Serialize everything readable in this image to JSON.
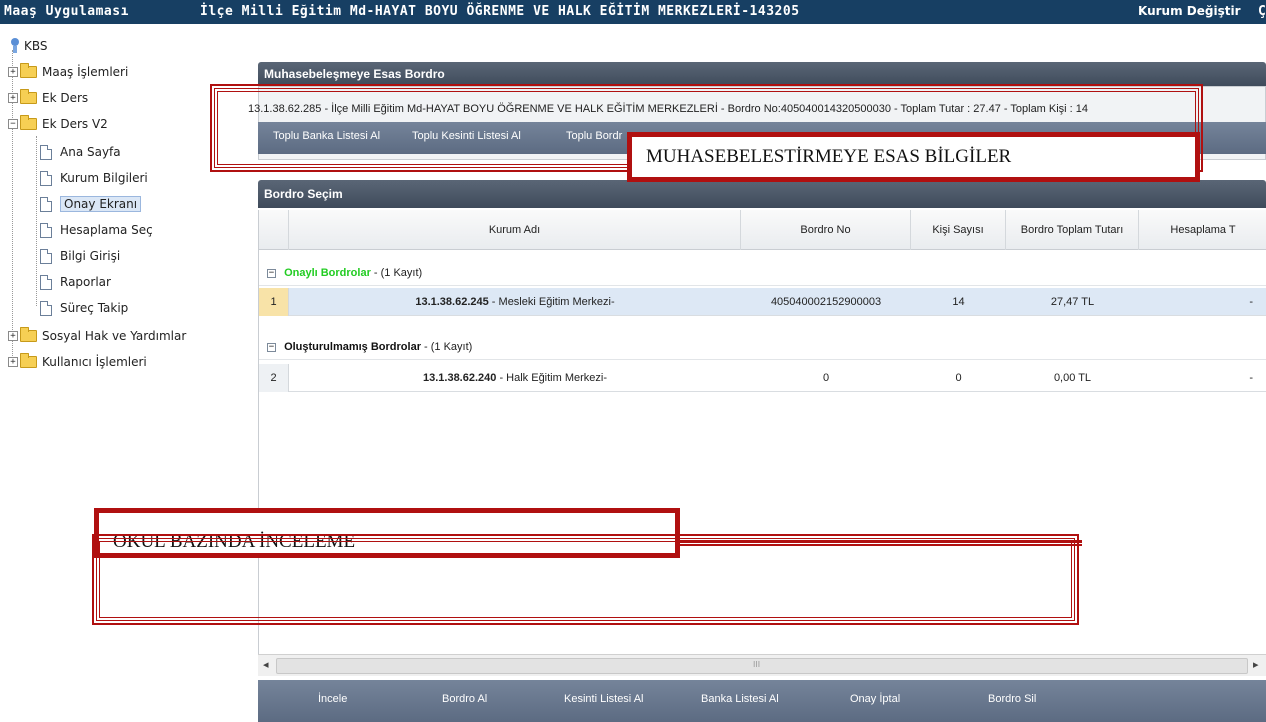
{
  "topbar": {
    "app_title": "Maaş Uygulaması",
    "institution": "İlçe Milli Eğitim Md-HAYAT BOYU ÖĞRENME VE HALK EĞİTİM MERKEZLERİ-143205",
    "change_institution": "Kurum Değiştir",
    "extra": "Ç"
  },
  "sidebar": {
    "root": "KBS",
    "items": [
      {
        "label": "Maaş İşlemleri",
        "type": "folder",
        "expander": "+"
      },
      {
        "label": "Ek Ders",
        "type": "folder",
        "expander": "+"
      },
      {
        "label": "Ek Ders V2",
        "type": "folder",
        "expander": "−"
      },
      {
        "label": "Ana Sayfa",
        "type": "page"
      },
      {
        "label": "Kurum Bilgileri",
        "type": "page"
      },
      {
        "label": "Onay Ekranı",
        "type": "page",
        "selected": true
      },
      {
        "label": "Hesaplama Seç",
        "type": "page"
      },
      {
        "label": "Bilgi Girişi",
        "type": "page"
      },
      {
        "label": "Raporlar",
        "type": "page"
      },
      {
        "label": "Süreç Takip",
        "type": "page"
      },
      {
        "label": "Sosyal Hak ve Yardımlar",
        "type": "folder",
        "expander": "+"
      },
      {
        "label": "Kullanıcı İşlemleri",
        "type": "folder",
        "expander": "+"
      }
    ]
  },
  "summary_panel": {
    "title": "Muhasebeleşmeye Esas Bordro",
    "text": "13.1.38.62.285 - İlçe Milli Eğitim Md-HAYAT BOYU ÖĞRENME VE HALK EĞİTİM MERKEZLERİ - Bordro No:405040014320500030 - Toplam Tutar : 27.47 - Toplam Kişi : 14",
    "buttons": [
      "Toplu Banka Listesi Al",
      "Toplu Kesinti Listesi Al",
      "Toplu Bordr"
    ]
  },
  "grid_panel": {
    "title": "Bordro Seçim",
    "columns": [
      "Kurum Adı",
      "Bordro No",
      "Kişi Sayısı",
      "Bordro Toplam Tutarı",
      "Hesaplama T"
    ],
    "groups": [
      {
        "name": "Onaylı Bordrolar",
        "count": " - (1 Kayıt)",
        "color": "#22cc22",
        "rows": [
          {
            "num": "1",
            "code": "13.1.38.62.245",
            "name": " - Mesleki Eğitim Merkezi-",
            "bordro_no": "405040002152900003",
            "kisi": "14",
            "tutar": "27,47 TL",
            "hesap": "-"
          }
        ]
      },
      {
        "name": "Oluşturulmamış Bordrolar",
        "count": " - (1 Kayıt)",
        "color": "#111111",
        "rows": [
          {
            "num": "2",
            "code": "13.1.38.62.240",
            "name": " - Halk Eğitim Merkezi-",
            "bordro_no": "0",
            "kisi": "0",
            "tutar": "0,00 TL",
            "hesap": "-"
          }
        ]
      }
    ],
    "scroll_glyphs": {
      "left": "◂",
      "mid": "III",
      "right": "▸"
    }
  },
  "bottom_buttons": [
    "İncele",
    "Bordro Al",
    "Kesinti Listesi Al",
    "Banka Listesi Al",
    "Onay İptal",
    "Bordro Sil"
  ],
  "callouts": {
    "top": "MUHASEBELESTİRMEYE ESAS BİLGİLER",
    "bottom": "OKUL BAZINDA İNCELEME"
  },
  "colors": {
    "topbar": "#173f63",
    "panel_header": "#4a5666",
    "highlight_red": "#b01010",
    "approved_green": "#22cc22"
  }
}
